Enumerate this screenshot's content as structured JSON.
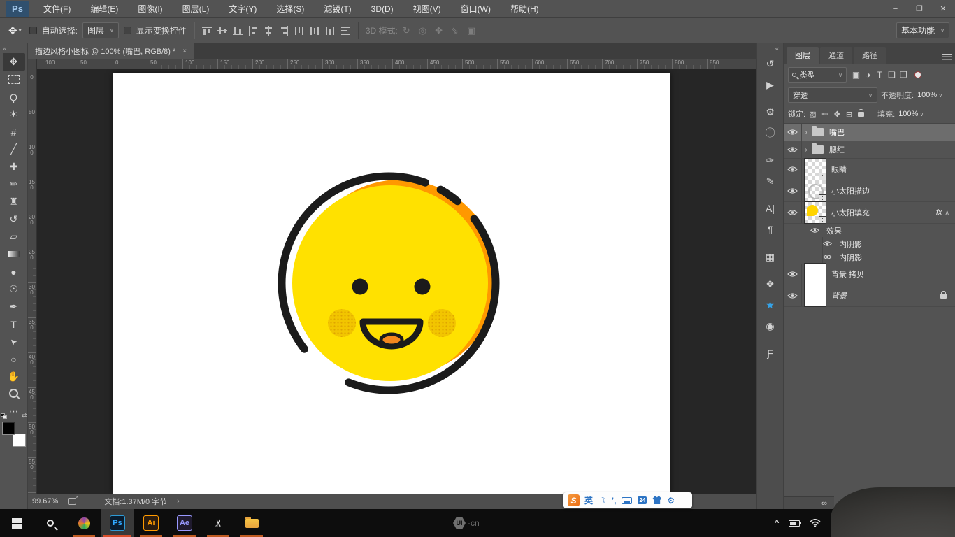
{
  "window": {
    "logo": "Ps",
    "controls": [
      {
        "name": "minimize-button",
        "glyph": "−"
      },
      {
        "name": "restore-button",
        "glyph": "❐"
      },
      {
        "name": "close-button",
        "glyph": "✕"
      }
    ]
  },
  "menu_bar": {
    "items": [
      {
        "label": "文件(F)"
      },
      {
        "label": "编辑(E)"
      },
      {
        "label": "图像(I)"
      },
      {
        "label": "图层(L)"
      },
      {
        "label": "文字(Y)"
      },
      {
        "label": "选择(S)"
      },
      {
        "label": "滤镜(T)"
      },
      {
        "label": "3D(D)"
      },
      {
        "label": "视图(V)"
      },
      {
        "label": "窗口(W)"
      },
      {
        "label": "帮助(H)"
      }
    ]
  },
  "options_bar": {
    "tool_glyph": "✥",
    "auto_select_label": "自动选择:",
    "auto_select_value": "图层",
    "show_transform_label": "显示变换控件",
    "align_icons": [
      {
        "name": "align-top-edges-icon",
        "cls": "i-at"
      },
      {
        "name": "align-vertical-centers-icon",
        "cls": "i-avc"
      },
      {
        "name": "align-bottom-edges-icon",
        "cls": "i-ab"
      },
      {
        "name": "align-left-edges-icon",
        "cls": "i-al"
      },
      {
        "name": "align-horizontal-centers-icon",
        "cls": "i-ahc"
      },
      {
        "name": "align-right-edges-icon",
        "cls": "i-ar"
      },
      {
        "name": "distribute-top-edges-icon",
        "cls": "i-dt"
      },
      {
        "name": "distribute-vertical-centers-icon",
        "cls": "i-dvc"
      },
      {
        "name": "distribute-bottom-edges-icon",
        "cls": "i-db"
      },
      {
        "name": "distribute-horizontal-centers-icon",
        "cls": "i-dh"
      }
    ],
    "mode_3d_label": "3D 模式:",
    "mode_3d_icons": [
      {
        "name": "3d-rotate-icon",
        "glyph": "↻"
      },
      {
        "name": "3d-roll-icon",
        "glyph": "◎"
      },
      {
        "name": "3d-drag-icon",
        "glyph": "✥"
      },
      {
        "name": "3d-slide-icon",
        "glyph": "⇘"
      },
      {
        "name": "3d-scale-icon",
        "glyph": "▣"
      }
    ],
    "workspace": "基本功能"
  },
  "document": {
    "tab_title": "描边风格小图标 @ 100% (嘴巴, RGB/8) *",
    "tab_close": "×",
    "toolbar_collapse": "»",
    "dock_collapse": "«",
    "rulers": {
      "horizontal": [
        "100",
        "50",
        "0",
        "50",
        "100",
        "150",
        "200",
        "250",
        "300",
        "350",
        "400",
        "450",
        "500",
        "550",
        "600",
        "650",
        "700",
        "750",
        "800",
        "850"
      ],
      "vertical": [
        "0",
        "50",
        "100",
        "150",
        "200",
        "250",
        "300",
        "350",
        "400",
        "450",
        "500",
        "550"
      ]
    },
    "status": {
      "zoom": "99.67%",
      "doc_info": "文档:1.37M/0 字节",
      "chevron": "›"
    }
  },
  "toolbar": {
    "tools": [
      {
        "name": "move-tool",
        "glyph": "✥",
        "selected": 1
      },
      {
        "name": "rectangular-marquee-tool",
        "cls": "t-marquee"
      },
      {
        "name": "lasso-tool",
        "glyph": "Ϙ"
      },
      {
        "name": "quick-selection-tool",
        "glyph": "✶"
      },
      {
        "name": "crop-tool",
        "glyph": "#"
      },
      {
        "name": "eyedropper-tool",
        "glyph": "╱"
      },
      {
        "name": "spot-healing-brush-tool",
        "glyph": "✚"
      },
      {
        "name": "brush-tool",
        "glyph": "✏"
      },
      {
        "name": "clone-stamp-tool",
        "glyph": "♜"
      },
      {
        "name": "history-brush-tool",
        "glyph": "↺"
      },
      {
        "name": "eraser-tool",
        "glyph": "▱"
      },
      {
        "name": "gradient-tool",
        "cls": "t-grad"
      },
      {
        "name": "blur-tool",
        "glyph": "●"
      },
      {
        "name": "dodge-tool",
        "glyph": "☉"
      },
      {
        "name": "pen-tool",
        "glyph": "✒"
      },
      {
        "name": "type-tool",
        "glyph": "T"
      },
      {
        "name": "path-selection-tool",
        "glyph": "➤",
        "cls": "rot-arrow"
      },
      {
        "name": "ellipse-tool",
        "glyph": "○"
      },
      {
        "name": "hand-tool",
        "glyph": "✋"
      },
      {
        "name": "zoom-tool",
        "cls": "t-zoom"
      },
      {
        "name": "edit-toolbar-icon",
        "glyph": "⋯"
      }
    ],
    "foreground_color": "#000000",
    "background_color": "#FFFFFF"
  },
  "panel_dock": {
    "icons": [
      {
        "name": "history-panel-icon",
        "glyph": "↺"
      },
      {
        "name": "actions-panel-icon",
        "glyph": "▶",
        "group_end": 1
      },
      {
        "name": "adjustments-panel-icon",
        "glyph": "⚙"
      },
      {
        "name": "info-panel-icon",
        "glyph": "ⓘ",
        "group_end": 1
      },
      {
        "name": "brushes-panel-icon",
        "glyph": "✑"
      },
      {
        "name": "brush-settings-panel-icon",
        "glyph": "✎",
        "group_end": 1
      },
      {
        "name": "character-panel-icon",
        "glyph": "A|"
      },
      {
        "name": "paragraph-panel-icon",
        "glyph": "¶",
        "group_end": 1
      },
      {
        "name": "glyphs-panel-icon",
        "glyph": "▦",
        "group_end": 1
      },
      {
        "name": "styles-panel-icon",
        "glyph": "❖"
      },
      {
        "name": "cc-libraries-panel-icon",
        "glyph": "★",
        "cls": "blue"
      },
      {
        "name": "adobe-color-panel-icon",
        "glyph": "◉",
        "group_end": 1
      },
      {
        "name": "paragraph-styles-panel-icon",
        "glyph": "Ƒ"
      }
    ]
  },
  "layers_panel": {
    "tabs": [
      {
        "label": "图层",
        "active": 1,
        "name": "tab-layers"
      },
      {
        "label": "通道",
        "name": "tab-channels"
      },
      {
        "label": "路径",
        "name": "tab-paths"
      }
    ],
    "filter_value": "类型",
    "filter_icons": [
      {
        "name": "filter-pixel-layers-icon",
        "glyph": "▣"
      },
      {
        "name": "filter-adjustment-layers-icon",
        "glyph": "◑"
      },
      {
        "name": "filter-type-layers-icon",
        "glyph": "T"
      },
      {
        "name": "filter-shape-layers-icon",
        "glyph": "❏"
      },
      {
        "name": "filter-smart-objects-icon",
        "glyph": "❐"
      }
    ],
    "blend_mode": "穿透",
    "opacity_label": "不透明度:",
    "opacity_value": "100%",
    "lock_label": "锁定:",
    "lock_icons": [
      {
        "name": "lock-transparent-pixels-icon",
        "glyph": "▨"
      },
      {
        "name": "lock-image-pixels-icon",
        "glyph": "✏"
      },
      {
        "name": "lock-position-icon",
        "glyph": "✥"
      },
      {
        "name": "lock-artboard-icon",
        "glyph": "⊞"
      },
      {
        "name": "lock-all-icon",
        "cls": "padlock"
      }
    ],
    "fill_label": "填充:",
    "fill_value": "100%",
    "layers": [
      {
        "label": "嘴巴",
        "kind": "group",
        "is_group": 1,
        "has_eye": 1,
        "selected": 1,
        "expander": "›"
      },
      {
        "label": "腮红",
        "kind": "group",
        "is_group": 1,
        "has_eye": 1,
        "expander": "›"
      },
      {
        "label": "眼睛",
        "kind": "smart",
        "has_eye": 1,
        "has_thumb": 1,
        "thumb": "checker",
        "badge": 1
      },
      {
        "label": "小太阳描边",
        "kind": "smart",
        "has_eye": 1,
        "has_thumb": 1,
        "thumb": "checker-stroke",
        "badge": 1
      },
      {
        "label": "小太阳填充",
        "kind": "smart",
        "has_eye": 1,
        "has_thumb": 1,
        "thumb": "checker-sun",
        "badge": 1,
        "fx": "fx",
        "collapse": "∧"
      },
      {
        "label": "效果",
        "kind": "effect",
        "indent": 1,
        "effect_eye": 1
      },
      {
        "label": "内阴影",
        "kind": "effect",
        "indent": 2,
        "effect_eye": 1
      },
      {
        "label": "内阴影",
        "kind": "effect",
        "indent": 2,
        "effect_eye": 1
      },
      {
        "label": "背景 拷贝",
        "kind": "flat",
        "has_eye": 1,
        "has_thumb": 1,
        "thumb": "white"
      },
      {
        "label": "背景",
        "kind": "flat",
        "has_eye": 1,
        "has_thumb": 1,
        "thumb": "white",
        "locked": 1,
        "italic": 1
      }
    ],
    "link_glyph": "∞"
  },
  "canvas": {
    "colors": {
      "face_yellow": "#FFE100",
      "crescent_orange": "#FF9800",
      "outline_black": "#1B1B1B",
      "tongue_orange": "#F5871E",
      "blush_base": "#F2C500",
      "blush_dot": "#DFA400"
    }
  },
  "ime_bar": {
    "logo": "S",
    "items": [
      {
        "name": "ime-language-icon",
        "glyph": "英"
      },
      {
        "name": "ime-moon-icon",
        "glyph": "☽"
      },
      {
        "name": "ime-punctuation-icon",
        "glyph": "’,"
      },
      {
        "name": "ime-keyboard-icon",
        "cls": "kbd"
      },
      {
        "name": "ime-smart-24-icon",
        "glyph": "24",
        "cls": "badge"
      },
      {
        "name": "ime-skin-icon",
        "cls": "shirt"
      },
      {
        "name": "ime-toolbox-icon",
        "glyph": "⚙"
      }
    ]
  },
  "taskbar": {
    "apps": [
      {
        "name": "taskbar-start-button",
        "cls": "t-win"
      },
      {
        "name": "taskbar-search-button",
        "cls": "t-search"
      },
      {
        "name": "taskbar-browser-icon",
        "cls": "t-chrome",
        "running": 1
      },
      {
        "name": "taskbar-photoshop-icon",
        "text": "Ps",
        "cls": "t-ps",
        "running": 1,
        "active": 1
      },
      {
        "name": "taskbar-illustrator-icon",
        "text": "Ai",
        "cls": "t-ai",
        "running": 1
      },
      {
        "name": "taskbar-aftereffects-icon",
        "text": "Ae",
        "cls": "t-ae",
        "running": 1
      },
      {
        "name": "taskbar-snip-icon",
        "text": "✂",
        "cls": "t-snip",
        "running": 1
      },
      {
        "name": "taskbar-explorer-icon",
        "cls": "t-folder",
        "running": 1
      }
    ],
    "watermark_logo": "UI",
    "watermark_suffix": "·cn",
    "tray_expand": "^"
  }
}
